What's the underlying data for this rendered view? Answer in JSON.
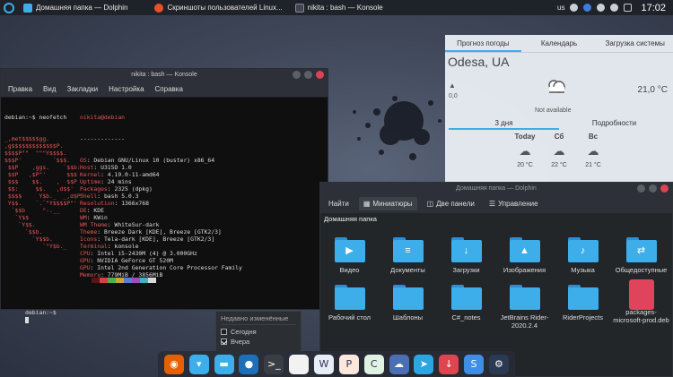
{
  "taskbar": {
    "tasks": [
      {
        "title": "Домашняя папка — Dolphin",
        "icon": "folder-icon",
        "color": "#3daee9"
      },
      {
        "title": "Скриншоты пользователей Linux...",
        "icon": "browser-icon",
        "color": "#e8502b"
      },
      {
        "title": "nikita : bash — Konsole",
        "icon": "terminal-icon",
        "color": "#2d3038"
      }
    ],
    "layout": "us",
    "clock": "17:02"
  },
  "weather": {
    "tabs": [
      "Прогноз погоды",
      "Календарь",
      "Загрузка системы"
    ],
    "city": "Odesa, UA",
    "wind": "0,0",
    "temp": "21,0 °C",
    "condition": "Not available",
    "subtabs": [
      "3 дня",
      "Подробности"
    ],
    "days": [
      {
        "name": "Today",
        "temp": "20 °C"
      },
      {
        "name": "Сб",
        "temp": "22 °C"
      },
      {
        "name": "Вс",
        "temp": "21 °C"
      }
    ]
  },
  "konsole": {
    "title": "nikita : bash — Konsole",
    "menu": [
      "Правка",
      "Вид",
      "Закладки",
      "Настройка",
      "Справка"
    ],
    "prompt1": "debian:~$ neofetch",
    "logo": [
      "_,met$$$$$gg.",
      ",g$$$$$$$$$$$$$P.",
      "$$$$P\"\"  \"\"\"Y$$$$.",
      "$$$P'         `$$$.",
      " $$P    ,ggs.    `$$b:",
      " $$P   ,$P\"'      $$$",
      " $$$    $$.    ,  $$P",
      " $$:     $$.   ,d$$'",
      " $$$$     Y$b._  _,d$P'",
      " Y$$.    `.`\"Y$$$$P\"'",
      "  `$$b     \"-.__",
      "   `Y$$",
      "    `Y$$.",
      "      `$$b.",
      "        `Y$$b.",
      "           `\"Y$b._"
    ],
    "user_host": "nikita@debian",
    "separator": "-------------",
    "info": [
      {
        "k": "OS",
        "v": "Debian GNU/Linux 10 (buster) x86_64"
      },
      {
        "k": "Host",
        "v": "U315D 1.0"
      },
      {
        "k": "Kernel",
        "v": "4.19.0-11-amd64"
      },
      {
        "k": "Uptime",
        "v": "24 mins"
      },
      {
        "k": "Packages",
        "v": "2325 (dpkg)"
      },
      {
        "k": "Shell",
        "v": "bash 5.0.3"
      },
      {
        "k": "Resolution",
        "v": "1366x768"
      },
      {
        "k": "DE",
        "v": "KDE"
      },
      {
        "k": "WM",
        "v": "KWin"
      },
      {
        "k": "WM Theme",
        "v": "WhiteSur-dark"
      },
      {
        "k": "Theme",
        "v": "Breeze Dark [KDE], Breeze [GTK2/3]"
      },
      {
        "k": "Icons",
        "v": "Tela-dark [KDE], Breeze [GTK2/3]"
      },
      {
        "k": "Terminal",
        "v": "konsole"
      },
      {
        "k": "CPU",
        "v": "Intel i5-2430M (4) @ 3.000GHz"
      },
      {
        "k": "GPU",
        "v": "NVIDIA GeForce GT 520M"
      },
      {
        "k": "GPU",
        "v": "Intel 2nd Generation Core Processor Family"
      },
      {
        "k": "Memory",
        "v": "779MiB / 3856MiB"
      }
    ],
    "palette": [
      "#5a1414",
      "#d84040",
      "#4caf50",
      "#c8a82a",
      "#5a7bd6",
      "#a04cb8",
      "#3fb3c0",
      "#d8d8d8"
    ],
    "prompt2": "debian:~$"
  },
  "dolphin": {
    "title": "Домашняя папка — Dolphin",
    "toolbar": {
      "find": "Найти",
      "thumbs": "Миниатюры",
      "split": "Две панели",
      "control": "Управление"
    },
    "breadcrumb": "Домашняя папка",
    "items": [
      {
        "label": "Видео",
        "glyph": "▶"
      },
      {
        "label": "Документы",
        "glyph": "≡"
      },
      {
        "label": "Загрузки",
        "glyph": "↓"
      },
      {
        "label": "Изображения",
        "glyph": "▲"
      },
      {
        "label": "Музыка",
        "glyph": "♪"
      },
      {
        "label": "Общедоступные",
        "glyph": "⇄"
      },
      {
        "label": "Рабочий стол",
        "glyph": ""
      },
      {
        "label": "Шаблоны",
        "glyph": ""
      },
      {
        "label": "C#_notes",
        "glyph": ""
      },
      {
        "label": "JetBrains Rider-2020.2.4",
        "glyph": ""
      },
      {
        "label": "RiderProjects",
        "glyph": ""
      },
      {
        "label": "packages-microsoft-prod.deb",
        "glyph": "deb"
      }
    ]
  },
  "recent": {
    "header": "Недавно изменённые",
    "rows": [
      {
        "label": "Сегодня",
        "checked": false
      },
      {
        "label": "Вчера",
        "checked": true
      }
    ]
  },
  "dock": [
    {
      "icon": "firefox-icon",
      "color": "#e66000",
      "glyph": "◉"
    },
    {
      "icon": "store-icon",
      "color": "#3daee9",
      "glyph": "▾"
    },
    {
      "icon": "folder-icon",
      "color": "#3daee9",
      "glyph": "▬"
    },
    {
      "icon": "toggle-icon",
      "color": "#1d6fb8",
      "glyph": "●"
    },
    {
      "icon": "terminal-icon",
      "color": "#3a3d44",
      "glyph": ">_"
    },
    {
      "icon": "document-icon",
      "color": "#f2f2f2",
      "glyph": ""
    },
    {
      "icon": "writer-icon",
      "color": "#e8eef8",
      "glyph": "W"
    },
    {
      "icon": "impress-icon",
      "color": "#fbe7dc",
      "glyph": "P"
    },
    {
      "icon": "calc-icon",
      "color": "#e0f2e2",
      "glyph": "C"
    },
    {
      "icon": "cloud-icon",
      "color": "#4a6fb5",
      "glyph": "☁"
    },
    {
      "icon": "telegram-icon",
      "color": "#2ca5e0",
      "glyph": "➤"
    },
    {
      "icon": "download-icon",
      "color": "#e0444e",
      "glyph": "↓"
    },
    {
      "icon": "skype-icon",
      "color": "#3f8ee6",
      "glyph": "S"
    },
    {
      "icon": "steam-icon",
      "color": "#2a3a52",
      "glyph": "⚙"
    }
  ]
}
